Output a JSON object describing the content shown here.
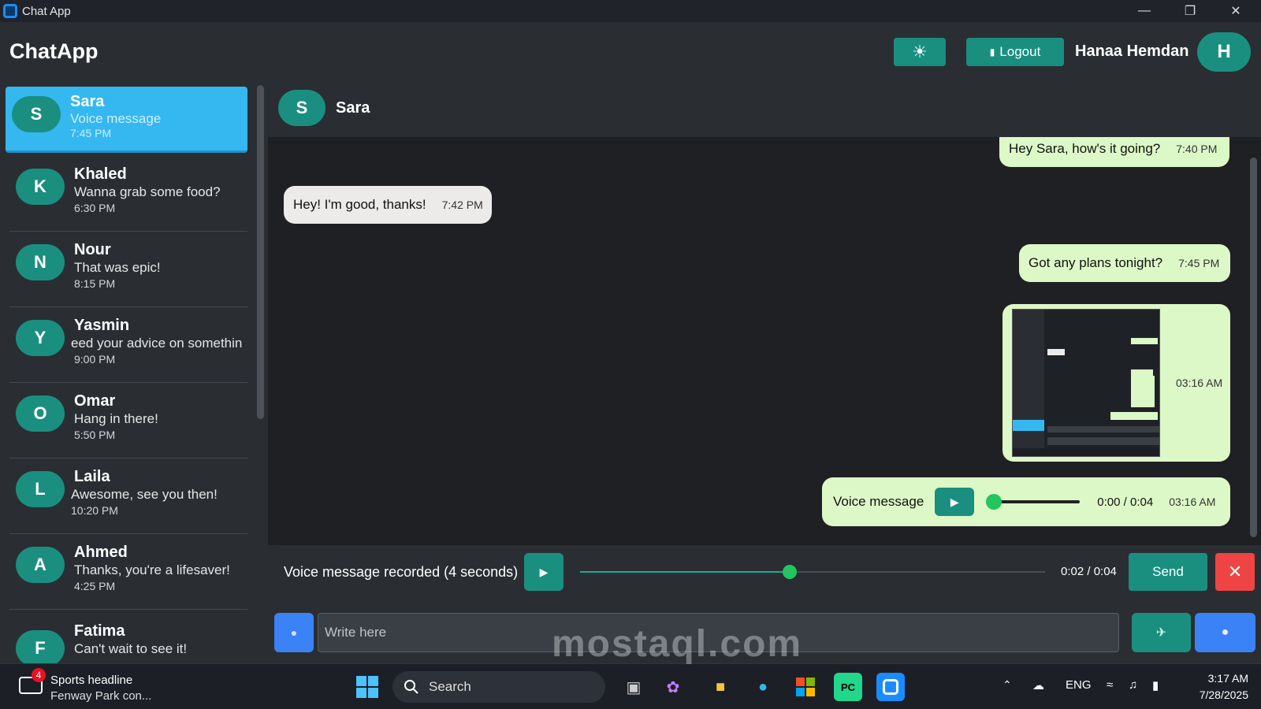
{
  "window": {
    "title": "Chat App",
    "controls": [
      "minimize",
      "restore",
      "close"
    ]
  },
  "header": {
    "brand": "ChatApp",
    "theme_toggle_icon": "sun-icon",
    "logout_label": "Logout",
    "user_name": "Hanaa Hemdan",
    "user_initial": "H"
  },
  "contacts": [
    {
      "initial": "S",
      "name": "Sara",
      "last_message": "Voice message",
      "time": "7:45 PM",
      "active": true
    },
    {
      "initial": "K",
      "name": "Khaled",
      "last_message": "Wanna grab some food?",
      "time": "6:30 PM"
    },
    {
      "initial": "N",
      "name": "Nour",
      "last_message": "That was epic!",
      "time": "8:15 PM"
    },
    {
      "initial": "Y",
      "name": "Yasmin",
      "last_message": "eed your advice on somethin",
      "time": "9:00 PM"
    },
    {
      "initial": "O",
      "name": "Omar",
      "last_message": "Hang in there!",
      "time": "5:50 PM"
    },
    {
      "initial": "L",
      "name": "Laila",
      "last_message": "Awesome, see you then!",
      "time": "10:20 PM"
    },
    {
      "initial": "A",
      "name": "Ahmed",
      "last_message": "Thanks, you're a lifesaver!",
      "time": "4:25 PM"
    },
    {
      "initial": "F",
      "name": "Fatima",
      "last_message": "Can't wait to see it!",
      "time": ""
    }
  ],
  "chat": {
    "contact_initial": "S",
    "contact_name": "Sara",
    "messages": [
      {
        "direction": "out",
        "text": "Hey Sara, how's it going?",
        "time": "7:40 PM"
      },
      {
        "direction": "in",
        "text": "Hey! I'm good, thanks!",
        "time": "7:42 PM"
      },
      {
        "direction": "out",
        "text": "Got any plans tonight?",
        "time": "7:45 PM"
      },
      {
        "direction": "out",
        "type": "image",
        "time": "03:16 AM"
      },
      {
        "direction": "out",
        "type": "voice",
        "text": "Voice message",
        "progress": "0:00 / 0:04",
        "time": "03:16 AM"
      }
    ]
  },
  "recording": {
    "label": "Voice message recorded (4 seconds)",
    "progress_text": "0:02 / 0:04",
    "progress_fraction": 0.5,
    "send_label": "Send",
    "cancel_icon": "close-icon"
  },
  "composer": {
    "placeholder": "Write here",
    "attach_icon": "attach-icon",
    "send_icon": "send-icon",
    "mic_icon": "mic-icon"
  },
  "taskbar": {
    "news_badge": "4",
    "news_title": "Sports headline",
    "news_subtitle": "Fenway Park con...",
    "search_label": "Search",
    "language": "ENG",
    "time": "3:17 AM",
    "date": "7/28/2025"
  },
  "watermark": "mostaql.com",
  "colors": {
    "accent": "#1a8f80",
    "active_contact": "#35b8f0",
    "outgoing_bubble": "#dcf8c6",
    "incoming_bubble": "#ecebea",
    "danger": "#ef4444",
    "blue_button": "#3b82f6"
  }
}
